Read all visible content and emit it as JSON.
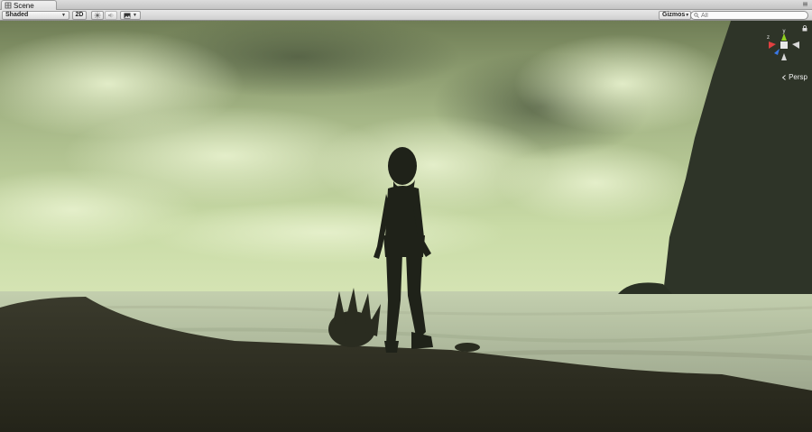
{
  "window": {
    "tab_title": "Scene",
    "tab_icon": "scene-icon"
  },
  "toolbar": {
    "render_mode": "Shaded",
    "mode_2d_label": "2D",
    "lighting_icon": "sun-icon",
    "audio_icon": "speaker-icon",
    "effects_icon": "image-icon",
    "gizmos_label": "Gizmos",
    "search_placeholder": "All",
    "search_icon": "search-icon"
  },
  "viewport": {
    "projection_label": "Persp",
    "axis_labels": {
      "y": "y",
      "z": "z"
    },
    "colors": {
      "x_axis": "#e04040",
      "y_axis": "#90d020",
      "z_axis": "#3a78e6"
    }
  }
}
